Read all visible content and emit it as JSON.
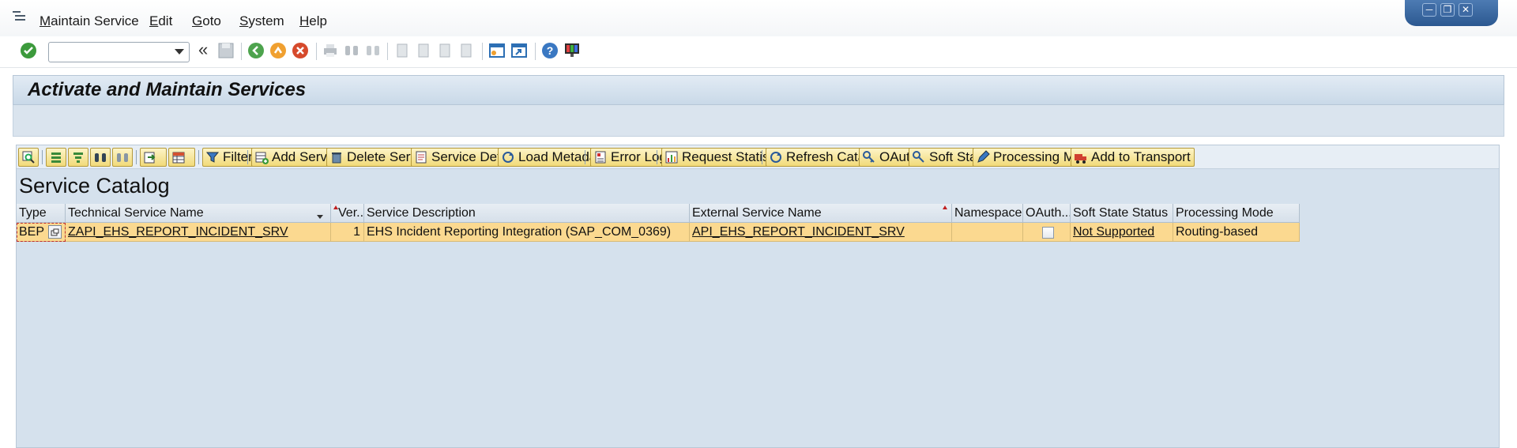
{
  "menu": {
    "items": [
      {
        "label": "aintain Service",
        "key": "M"
      },
      {
        "label": "dit",
        "key": "E"
      },
      {
        "label": "oto",
        "key": "G"
      },
      {
        "label": "ystem",
        "key": "S"
      },
      {
        "label": "elp",
        "key": "H"
      }
    ]
  },
  "window_controls": {
    "minimize": "─",
    "restore": "❐",
    "close": "✕"
  },
  "command_field": {
    "value": "",
    "placeholder": ""
  },
  "app_title": "Activate and Maintain Services",
  "alv_toolbar": {
    "filter": "Filter",
    "add_service": "Add Service",
    "delete_service": "Delete Service",
    "service_details": "Service Details",
    "load_metadata": "Load Metadata",
    "error_log": "Error Log",
    "request_statistics": "Request Statistics",
    "refresh_catalog": "Refresh Catalog",
    "oauth": "OAuth",
    "soft_state": "Soft State",
    "processing_mode": "Processing Mode",
    "add_to_transport": "Add to Transport"
  },
  "catalog": {
    "title": "Service Catalog",
    "columns": [
      "Type",
      "Technical Service Name",
      "Ver...",
      "Service Description",
      "External Service Name",
      "Namespace",
      "OAuth...",
      "Soft State Status",
      "Processing Mode"
    ],
    "rows": [
      {
        "type": "BEP",
        "technical_name": "ZAPI_EHS_REPORT_INCIDENT_SRV",
        "version": "1",
        "description": "EHS Incident Reporting Integration (SAP_COM_0369)",
        "external_name": "API_EHS_REPORT_INCIDENT_SRV",
        "namespace": "",
        "oauth": false,
        "soft_state": "Not Supported",
        "processing_mode": "Routing-based"
      }
    ]
  },
  "colors": {
    "selected_row": "#fbd990",
    "header_bg": "#d6e0ea",
    "alv_bg": "#d5e1ed",
    "button_bg": "#f1da79"
  }
}
